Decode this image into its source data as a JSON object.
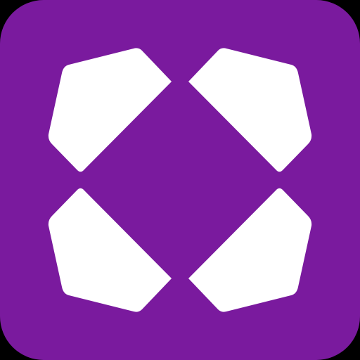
{
  "app_icon": {
    "name": "app-logo-icon",
    "background_color": "#7A1A9E",
    "shape_color": "#FFFFFF",
    "page_background": "#000000"
  }
}
